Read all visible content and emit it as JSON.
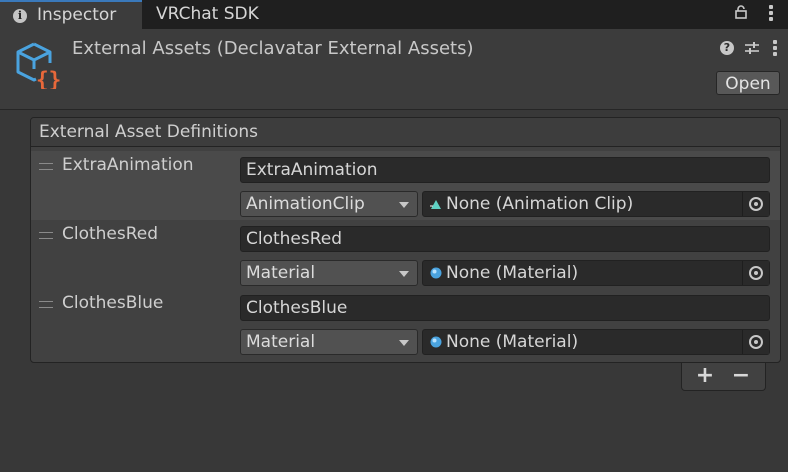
{
  "tabs": [
    {
      "label": "Inspector",
      "active": true,
      "icon": "info-icon"
    },
    {
      "label": "VRChat SDK",
      "active": false
    }
  ],
  "header": {
    "title": "External Assets (Declavatar External Assets)",
    "icon": "cube-script-icon",
    "open_label": "Open"
  },
  "panel": {
    "title": "External Asset Definitions",
    "rows": [
      {
        "name": "ExtraAnimation",
        "key": "ExtraAnimation",
        "type": "AnimationClip",
        "object": "None (Animation Clip)",
        "object_icon": "animation-clip-icon",
        "selected": true
      },
      {
        "name": "ClothesRed",
        "key": "ClothesRed",
        "type": "Material",
        "object": "None (Material)",
        "object_icon": "material-icon",
        "selected": false
      },
      {
        "name": "ClothesBlue",
        "key": "ClothesBlue",
        "type": "Material",
        "object": "None (Material)",
        "object_icon": "material-icon",
        "selected": false
      }
    ]
  },
  "list_controls": {
    "add": "+",
    "remove": "−"
  },
  "colors": {
    "accent_tab": "#3a79bb",
    "cube_blue": "#4aa3df",
    "brace_orange": "#e8683a"
  }
}
